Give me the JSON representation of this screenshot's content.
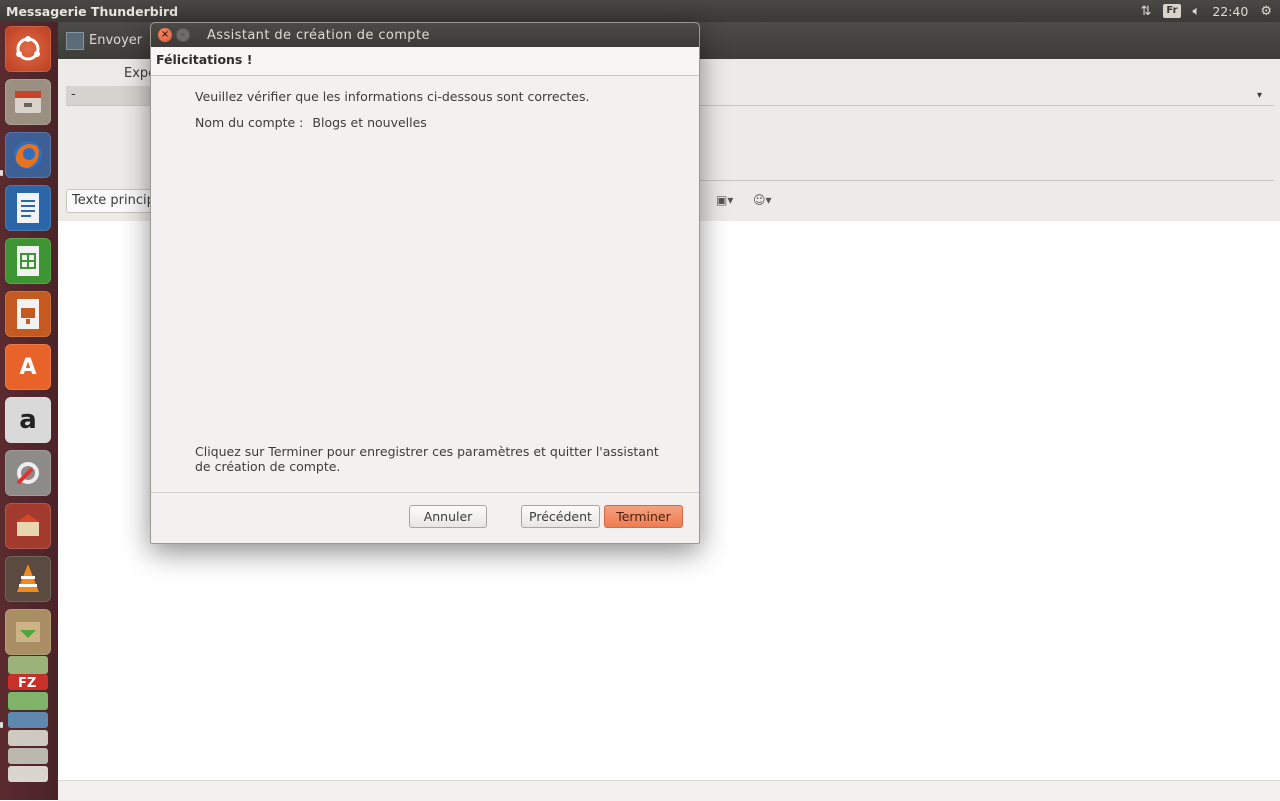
{
  "top_panel": {
    "app_title": "Messagerie Thunderbird",
    "keyboard_layout": "Fr",
    "clock": "22:40",
    "icons": [
      "network-icon",
      "volume-icon",
      "session-gear-icon"
    ]
  },
  "launcher": {
    "items": [
      {
        "name": "ubuntu-dash-icon",
        "color": "#d84e2b"
      },
      {
        "name": "files-icon",
        "color": "#8a7f70"
      },
      {
        "name": "firefox-icon",
        "color": "#e56a1c"
      },
      {
        "name": "libreoffice-writer-icon",
        "color": "#2b6fb0"
      },
      {
        "name": "libreoffice-calc-icon",
        "color": "#3e9a35"
      },
      {
        "name": "libreoffice-impress-icon",
        "color": "#c65a1f"
      },
      {
        "name": "software-center-icon",
        "color": "#e8632a"
      },
      {
        "name": "amazon-icon",
        "color": "#e6e6e6"
      },
      {
        "name": "system-settings-icon",
        "color": "#8d8b87"
      },
      {
        "name": "app-icon",
        "color": "#b03a2e"
      },
      {
        "name": "vlc-icon",
        "color": "#f08a1c"
      },
      {
        "name": "archive-manager-icon",
        "color": "#bda57a"
      },
      {
        "name": "stacked-apps-icon",
        "color": "#9bb27a"
      }
    ]
  },
  "compose": {
    "send_label": "Envoyer",
    "from_label": "Expe",
    "from_dash": "-",
    "format_value": "Texte principal"
  },
  "dialog": {
    "title": "Assistant de création de compte",
    "header": "Félicitations !",
    "intro": "Veuillez vérifier que les informations ci-dessous sont correctes.",
    "account_label": "Nom du compte :",
    "account_value": "Blogs et nouvelles",
    "finish_text": "Cliquez sur Terminer pour enregistrer ces paramètres et quitter l'assistant de création de compte.",
    "buttons": {
      "cancel": "Annuler",
      "previous": "Précédent",
      "finish": "Terminer"
    },
    "accent_color": "#ee7c51"
  }
}
